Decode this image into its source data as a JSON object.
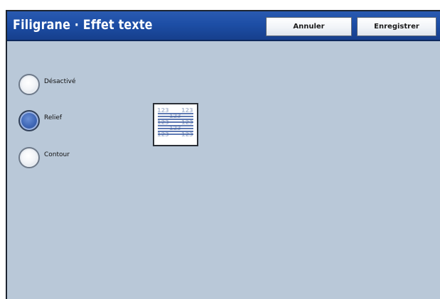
{
  "header": {
    "title": "Filigrane · Effet texte",
    "cancel_label": "Annuler",
    "save_label": "Enregistrer"
  },
  "options": [
    {
      "label": "Désactivé",
      "selected": false
    },
    {
      "label": "Relief",
      "selected": true
    },
    {
      "label": "Contour",
      "selected": false
    }
  ],
  "preview": {
    "lines": [
      "123",
      "123",
      "123",
      "123",
      "123",
      "123",
      "123",
      "123"
    ]
  },
  "colors": {
    "header_bg": "#1d4ea6",
    "panel_bg": "#b9c8d8",
    "selected_radio": "#3f67b6",
    "preview_lines": "#2a4f9a",
    "preview_text": "#8ea2c4"
  }
}
